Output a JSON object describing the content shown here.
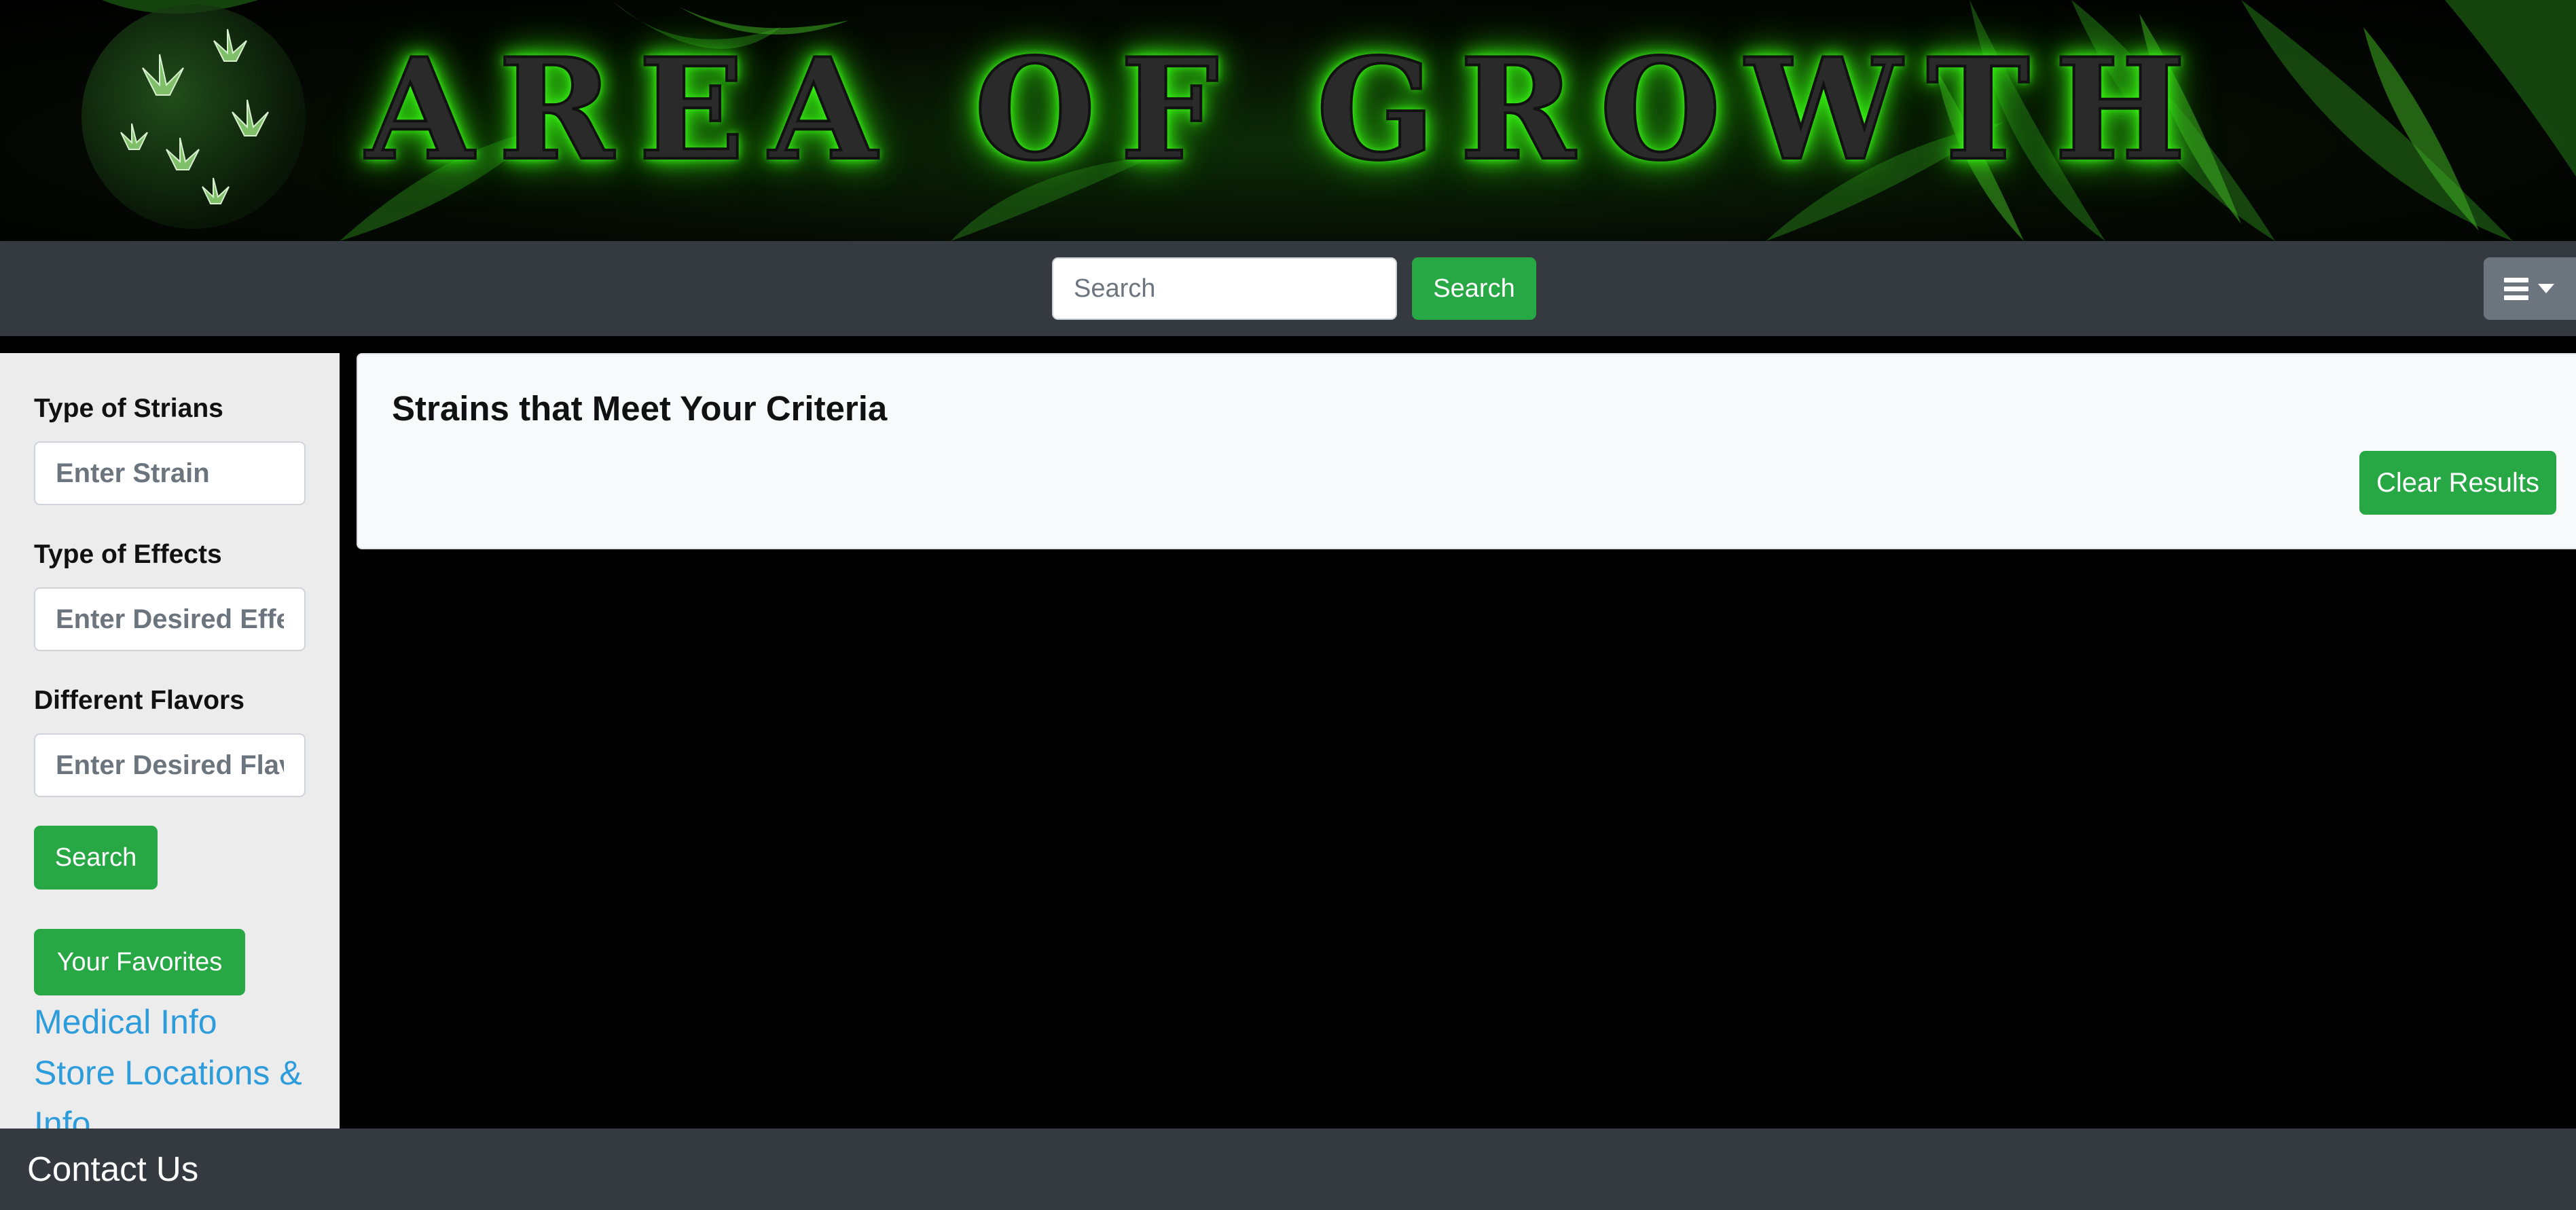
{
  "banner": {
    "title": "AREA OF GROWTH",
    "logo_icon": "leaf-globe-icon"
  },
  "navbar": {
    "search_placeholder": "Search",
    "search_button": "Search",
    "menu_icon": "hamburger-menu-icon"
  },
  "sidebar": {
    "strains_label": "Type of Strians",
    "strains_placeholder": "Enter Strain",
    "effects_label": "Type of Effects",
    "effects_placeholder": "Enter Desired Effects",
    "flavors_label": "Different Flavors",
    "flavors_placeholder": "Enter Desired Flavors",
    "search_button": "Search",
    "favorites_button": "Your Favorites",
    "links": [
      "Medical Info",
      "Store Locations & Info"
    ]
  },
  "results": {
    "title": "Strains that Meet Your Criteria",
    "clear_button": "Clear Results"
  },
  "footer": {
    "contact_label": "Contact Us"
  },
  "colors": {
    "navbar": "#343a40",
    "accent_green": "#28a745",
    "link_blue": "#2d9cdb",
    "menu_gray": "#6c757d"
  }
}
